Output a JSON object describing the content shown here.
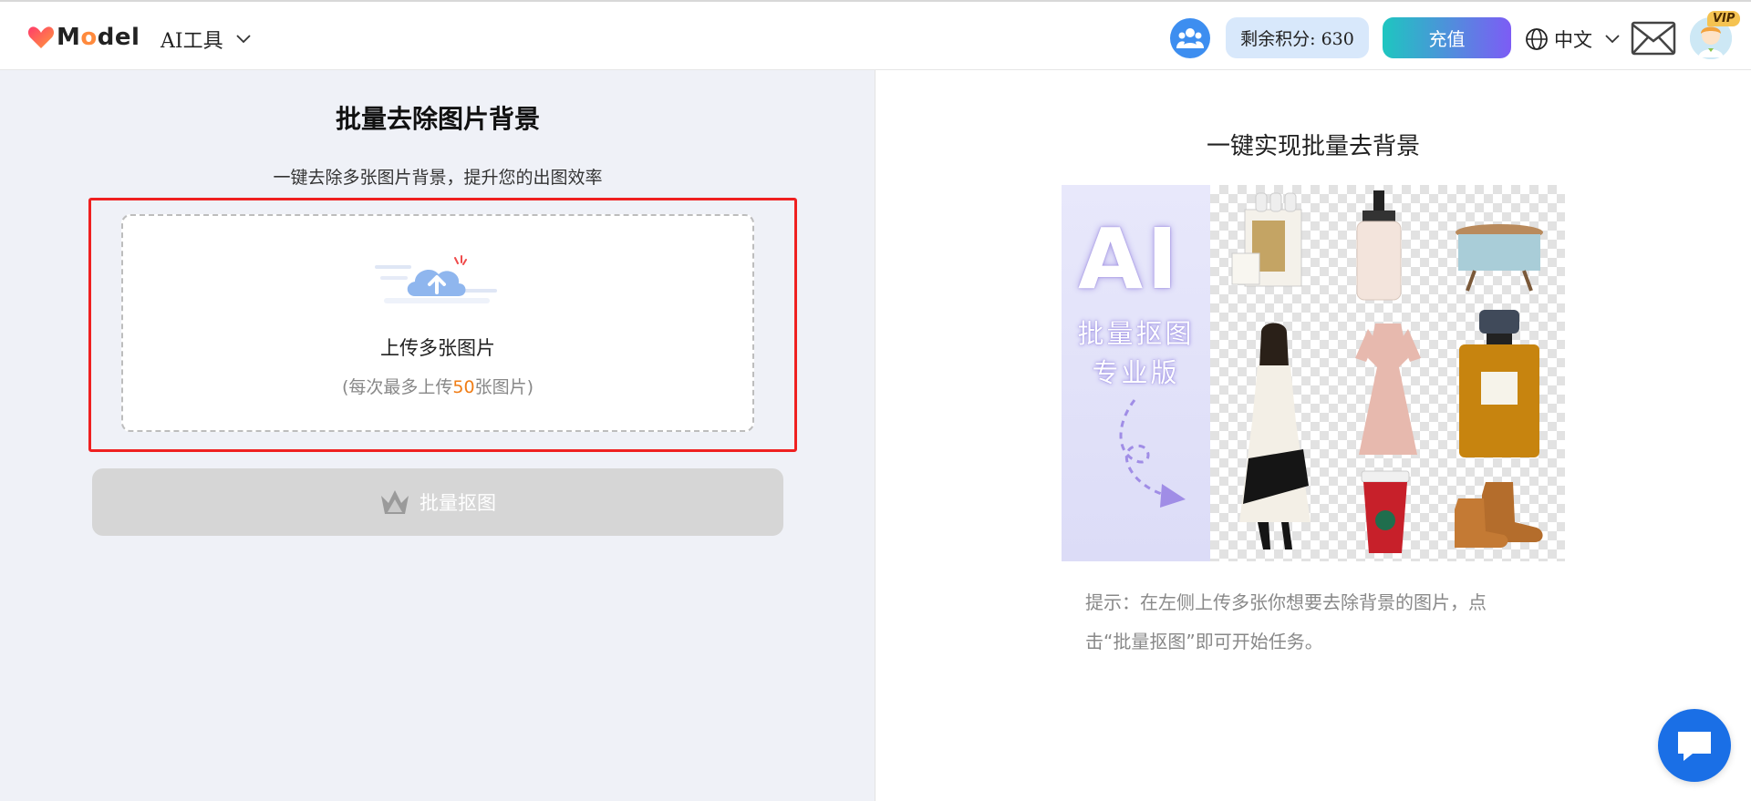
{
  "header": {
    "logo_prefix": "M",
    "logo_o": "o",
    "logo_suffix": "del",
    "tools_menu_label": "AI工具",
    "points_label": "剩余积分: 630",
    "recharge_label": "充值",
    "language_label": "中文",
    "vip_badge": "VIP"
  },
  "left": {
    "title": "批量去除图片背景",
    "subtitle": "一键去除多张图片背景，提升您的出图效率",
    "upload_title": "上传多张图片",
    "upload_limit_prefix": "(每次最多上传",
    "upload_limit_number": "50",
    "upload_limit_suffix": "张图片)",
    "batch_button_label": "批量抠图"
  },
  "right": {
    "title": "一键实现批量去背景",
    "showcase_big": "AI",
    "showcase_line1": "批量抠图",
    "showcase_line2": "专业版",
    "tip": "提示：在左侧上传多张你想要去除背景的图片，点击“批量抠图”即可开始任务。"
  },
  "colors": {
    "accent_gradient_start": "#1ec6c0",
    "accent_gradient_end": "#7d5cf5",
    "highlight_frame": "#ef2020",
    "limit_number": "#f07d16",
    "chat_button": "#1a6fe6"
  },
  "icons": [
    "heart-logo-icon",
    "chevron-down-icon",
    "community-icon",
    "globe-icon",
    "mail-icon",
    "avatar-icon",
    "cloud-upload-icon",
    "crown-icon",
    "chat-icon"
  ]
}
